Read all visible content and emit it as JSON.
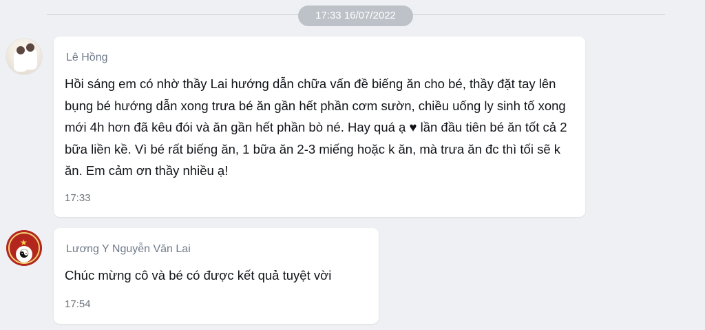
{
  "chat": {
    "date_separator": "17:33 16/07/2022",
    "messages": [
      {
        "sender": "Lê Hồng",
        "text": "Hồi sáng em có nhờ thầy Lai hướng dẫn chữa vấn đề biếng ăn cho bé, thầy đặt tay lên bụng bé hướng dẫn xong trưa bé ăn gần hết phần cơm sườn, chiều uống ly sinh tố xong mới 4h hơn đã kêu đói và ăn gần hết phần bò né. Hay quá ạ ♥ lần đầu tiên bé ăn tốt cả 2 bữa liền kề. Vì bé rất biếng ăn, 1 bữa ăn 2-3 miếng hoặc k ăn, mà trưa ăn đc thì tối sẽ k ăn. Em cảm ơn thầy nhiều ạ!",
        "time": "17:33",
        "avatar_icon": "user-photo-avatar"
      },
      {
        "sender": "Lương Y Nguyễn Văn Lai",
        "text": "Chúc mừng cô và bé có được kết quả tuyệt vời",
        "time": "17:54",
        "avatar_icon": "yin-yang-emblem-avatar"
      }
    ]
  },
  "colors": {
    "background": "#eef0f3",
    "bubble": "#ffffff",
    "sender_name": "#6e7a8a",
    "message_text": "#111318",
    "timestamp": "#6d737b",
    "date_pill": "#bdc2c8"
  }
}
